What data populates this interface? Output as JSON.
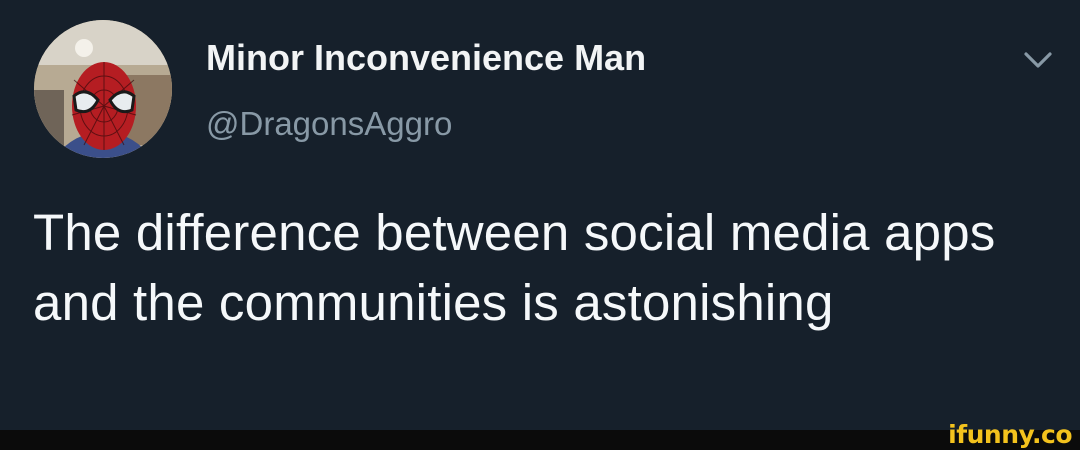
{
  "tweet": {
    "author": {
      "display_name": "Minor Inconvenience Man",
      "handle": "@DragonsAggro",
      "avatar_icon": "spiderman-mask-avatar"
    },
    "menu_icon": "chevron-down-icon",
    "text": "The difference between social media apps and the communities is astonishing"
  },
  "watermark": {
    "text": "ifunny.co",
    "color": "#f3c21d"
  },
  "colors": {
    "background": "#16202b",
    "name": "#f2f4f5",
    "handle": "#8899a6",
    "text": "#f5f8fa"
  }
}
